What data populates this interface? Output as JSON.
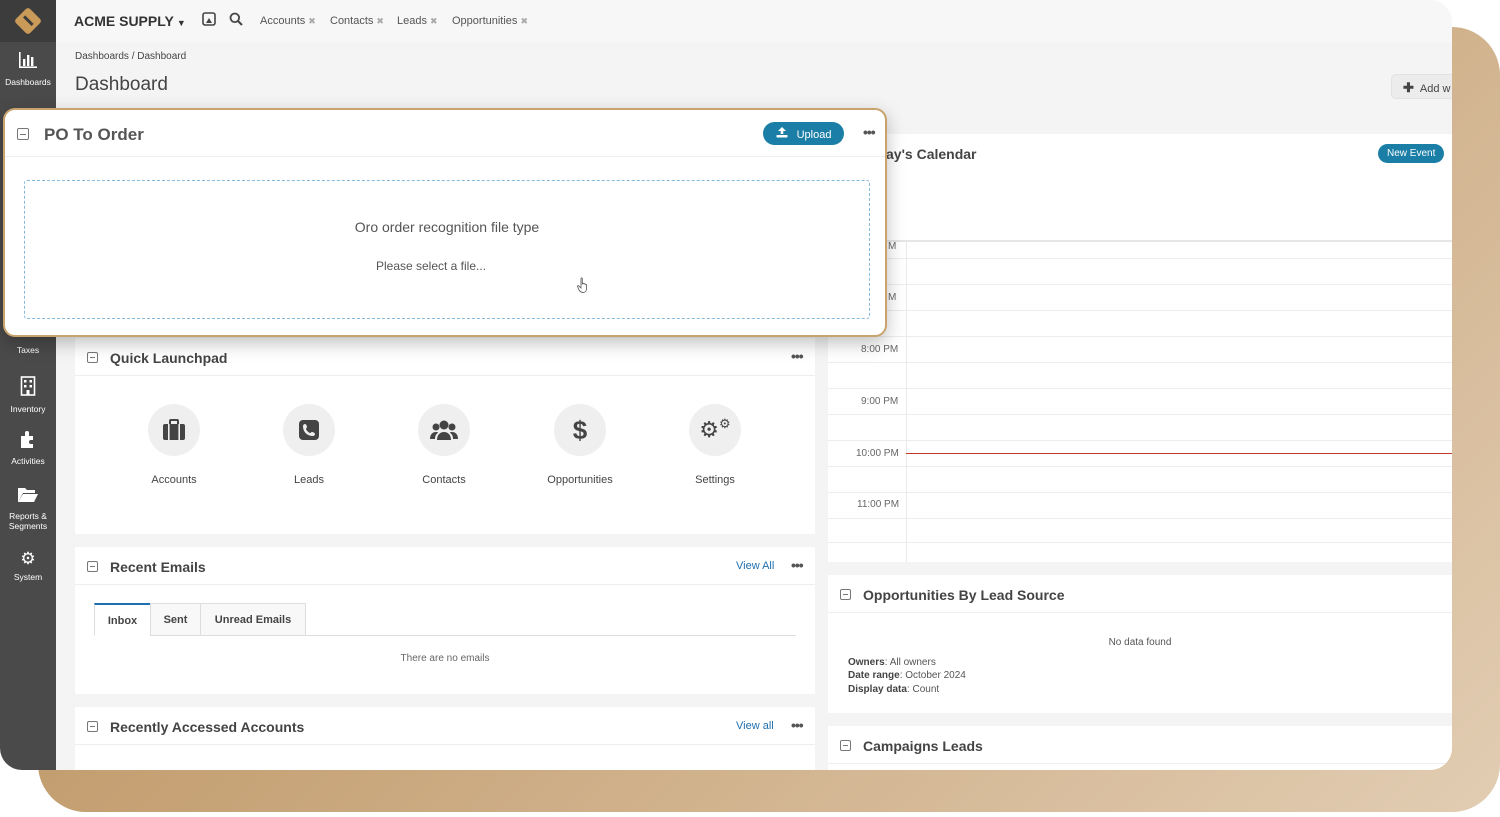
{
  "topbar": {
    "brand": "ACME SUPPLY",
    "tabs": [
      {
        "label": "Accounts"
      },
      {
        "label": "Contacts"
      },
      {
        "label": "Leads"
      },
      {
        "label": "Opportunities"
      }
    ]
  },
  "sidebar": {
    "items": [
      {
        "label": "Dashboards",
        "icon": "bar-chart-icon"
      },
      {
        "label": "Taxes",
        "icon": "percent-icon"
      },
      {
        "label": "Inventory",
        "icon": "building-icon"
      },
      {
        "label": "Activities",
        "icon": "puzzle-icon"
      },
      {
        "label": "Reports &",
        "label2": "Segments",
        "icon": "folder-icon"
      },
      {
        "label": "System",
        "icon": "gear-icon"
      }
    ]
  },
  "header": {
    "breadcrumb": "Dashboards / Dashboard",
    "title": "Dashboard",
    "add_widget": "Add w"
  },
  "po_widget": {
    "title": "PO To Order",
    "upload_label": "Upload",
    "drop_title": "Oro order recognition file type",
    "drop_hint": "Please select a file..."
  },
  "launchpad": {
    "title": "Quick Launchpad",
    "items": [
      {
        "label": "Accounts",
        "icon": "briefcase-icon"
      },
      {
        "label": "Leads",
        "icon": "phone-icon"
      },
      {
        "label": "Contacts",
        "icon": "users-icon"
      },
      {
        "label": "Opportunities",
        "icon": "dollar-icon"
      },
      {
        "label": "Settings",
        "icon": "gears-icon"
      }
    ]
  },
  "recent_emails": {
    "title": "Recent Emails",
    "view_all": "View All",
    "tabs": [
      "Inbox",
      "Sent",
      "Unread Emails"
    ],
    "empty": "There are no emails"
  },
  "recent_accounts": {
    "title": "Recently Accessed Accounts",
    "view_all": "View all"
  },
  "calendar": {
    "title": "ay's Calendar",
    "new_event": "New Event",
    "times": [
      "M",
      "M",
      "8:00 PM",
      "9:00 PM",
      "10:00 PM",
      "11:00 PM"
    ]
  },
  "opportunities": {
    "title": "Opportunities By Lead Source",
    "no_data": "No data found",
    "owners_label": "Owners",
    "owners_value": ": All owners",
    "range_label": "Date range",
    "range_value": ": October 2024",
    "display_label": "Display data",
    "display_value": ": Count"
  },
  "campaigns": {
    "title": "Campaigns Leads"
  },
  "colors": {
    "accent": "#1a7ea6",
    "sidebar": "#4a4a4a",
    "highlight_border": "#c8a36d",
    "now_line": "#c0392b"
  }
}
